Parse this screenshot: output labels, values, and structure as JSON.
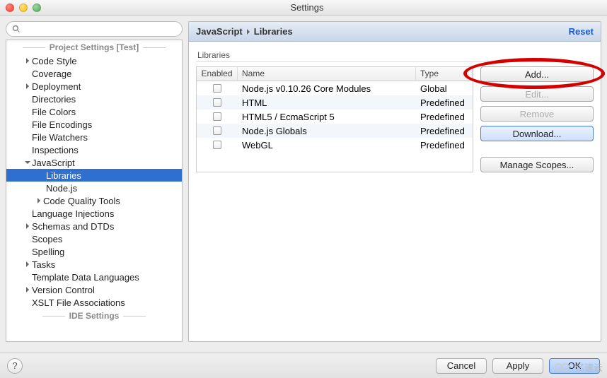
{
  "window": {
    "title": "Settings"
  },
  "search": {
    "placeholder": ""
  },
  "tree": {
    "sections": [
      "Project Settings [Test]",
      "IDE Settings"
    ],
    "items": [
      {
        "label": "Code Style",
        "arrow": true,
        "indent": 1
      },
      {
        "label": "Coverage",
        "arrow": false,
        "indent": 1
      },
      {
        "label": "Deployment",
        "arrow": true,
        "indent": 1
      },
      {
        "label": "Directories",
        "arrow": false,
        "indent": 1
      },
      {
        "label": "File Colors",
        "arrow": false,
        "indent": 1
      },
      {
        "label": "File Encodings",
        "arrow": false,
        "indent": 1
      },
      {
        "label": "File Watchers",
        "arrow": false,
        "indent": 1
      },
      {
        "label": "Inspections",
        "arrow": false,
        "indent": 1
      },
      {
        "label": "JavaScript",
        "arrow": "down",
        "indent": 1
      },
      {
        "label": "Libraries",
        "arrow": false,
        "indent": 3,
        "selected": true
      },
      {
        "label": "Node.js",
        "arrow": false,
        "indent": 3
      },
      {
        "label": "Code Quality Tools",
        "arrow": true,
        "indent": 2
      },
      {
        "label": "Language Injections",
        "arrow": false,
        "indent": 1
      },
      {
        "label": "Schemas and DTDs",
        "arrow": true,
        "indent": 1
      },
      {
        "label": "Scopes",
        "arrow": false,
        "indent": 1
      },
      {
        "label": "Spelling",
        "arrow": false,
        "indent": 1
      },
      {
        "label": "Tasks",
        "arrow": true,
        "indent": 1
      },
      {
        "label": "Template Data Languages",
        "arrow": false,
        "indent": 1
      },
      {
        "label": "Version Control",
        "arrow": true,
        "indent": 1
      },
      {
        "label": "XSLT File Associations",
        "arrow": false,
        "indent": 1
      }
    ]
  },
  "breadcrumb": {
    "root": "JavaScript",
    "leaf": "Libraries",
    "reset": "Reset"
  },
  "panel": {
    "label": "Libraries",
    "columns": {
      "enabled": "Enabled",
      "name": "Name",
      "type": "Type"
    },
    "rows": [
      {
        "name": "Node.js v0.10.26 Core Modules",
        "type": "Global"
      },
      {
        "name": "HTML",
        "type": "Predefined"
      },
      {
        "name": "HTML5 / EcmaScript 5",
        "type": "Predefined"
      },
      {
        "name": "Node.js Globals",
        "type": "Predefined"
      },
      {
        "name": "WebGL",
        "type": "Predefined"
      }
    ]
  },
  "buttons": {
    "add": "Add...",
    "edit": "Edit...",
    "remove": "Remove",
    "download": "Download...",
    "scopes": "Manage Scopes..."
  },
  "bottom": {
    "cancel": "Cancel",
    "apply": "Apply",
    "ok": "OK"
  },
  "watermark": "亿速云"
}
